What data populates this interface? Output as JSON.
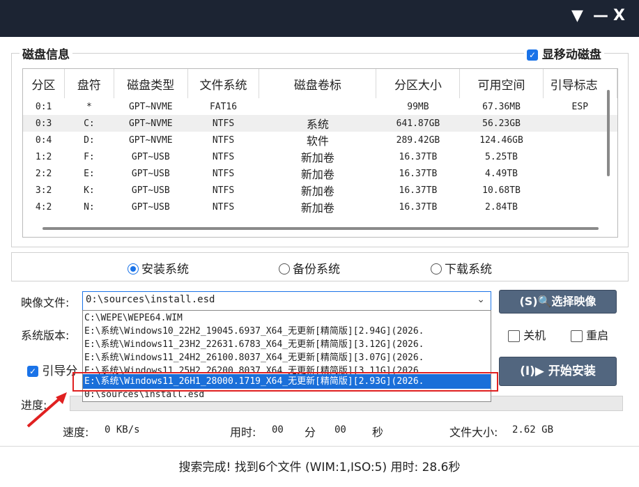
{
  "window": {
    "controls": {
      "dropdown": "▼",
      "minimize": "—",
      "close": "X"
    }
  },
  "disk_info": {
    "title": "磁盘信息",
    "show_removable": {
      "label": "显移动磁盘",
      "checked": true
    },
    "columns": [
      "分区",
      "盘符",
      "磁盘类型",
      "文件系统",
      "磁盘卷标",
      "分区大小",
      "可用空间",
      "引导标志"
    ],
    "rows": [
      [
        "0:1",
        "*",
        "GPT~NVME",
        "FAT16",
        "",
        "99MB",
        "67.36MB",
        "ESP"
      ],
      [
        "0:3",
        "C:",
        "GPT~NVME",
        "NTFS",
        "系统",
        "641.87GB",
        "56.23GB",
        ""
      ],
      [
        "0:4",
        "D:",
        "GPT~NVME",
        "NTFS",
        "软件",
        "289.42GB",
        "124.46GB",
        ""
      ],
      [
        "1:2",
        "F:",
        "GPT~USB",
        "NTFS",
        "新加卷",
        "16.37TB",
        "5.25TB",
        ""
      ],
      [
        "2:2",
        "E:",
        "GPT~USB",
        "NTFS",
        "新加卷",
        "16.37TB",
        "4.49TB",
        ""
      ],
      [
        "3:2",
        "K:",
        "GPT~USB",
        "NTFS",
        "新加卷",
        "16.37TB",
        "10.68TB",
        ""
      ],
      [
        "4:2",
        "N:",
        "GPT~USB",
        "NTFS",
        "新加卷",
        "16.37TB",
        "2.84TB",
        ""
      ]
    ]
  },
  "modes": [
    {
      "label": "安装系统",
      "selected": true
    },
    {
      "label": "备份系统",
      "selected": false
    },
    {
      "label": "下载系统",
      "selected": false
    }
  ],
  "image_file": {
    "label": "映像文件:",
    "value": "0:\\sources\\install.esd",
    "options": [
      "C:\\WEPE\\WEPE64.WIM",
      "E:\\系统\\Windows10_22H2_19045.6937_X64_无更新[精简版][2.94G](2026.",
      "E:\\系统\\Windows11_23H2_22631.6783_X64_无更新[精简版][3.12G](2026.",
      "E:\\系统\\Windows11_24H2_26100.8037_X64_无更新[精简版][3.07G](2026.",
      "E:\\系统\\Windows11_25H2_26200.8037_X64_无更新[精简版][3.11G](2026.",
      "E:\\系统\\Windows11_26H1_28000.1719_X64_无更新[精简版][2.93G](2026.",
      "0:\\sources\\install.esd"
    ],
    "highlighted_index": 5
  },
  "select_image_button": "(S)🔍选择映像",
  "system_version_label": "系统版本:",
  "shutdown": {
    "label": "关机",
    "checked": false
  },
  "restart": {
    "label": "重启",
    "checked": false
  },
  "boot_partition": {
    "label": "引导分",
    "checked": true
  },
  "install_button": "(I)▶ 开始安装",
  "progress": {
    "label": "进度:",
    "value": 0
  },
  "stats": {
    "speed_label": "速度:",
    "speed_value": "0 KB/s",
    "time_label": "用时:",
    "minutes": "00",
    "minute_unit": "分",
    "seconds": "00",
    "second_unit": "秒",
    "file_size_label": "文件大小:",
    "file_size_value": "2.62 GB"
  },
  "status": "搜索完成! 找到6个文件 (WIM:1,ISO:5) 用时: 28.6秒"
}
